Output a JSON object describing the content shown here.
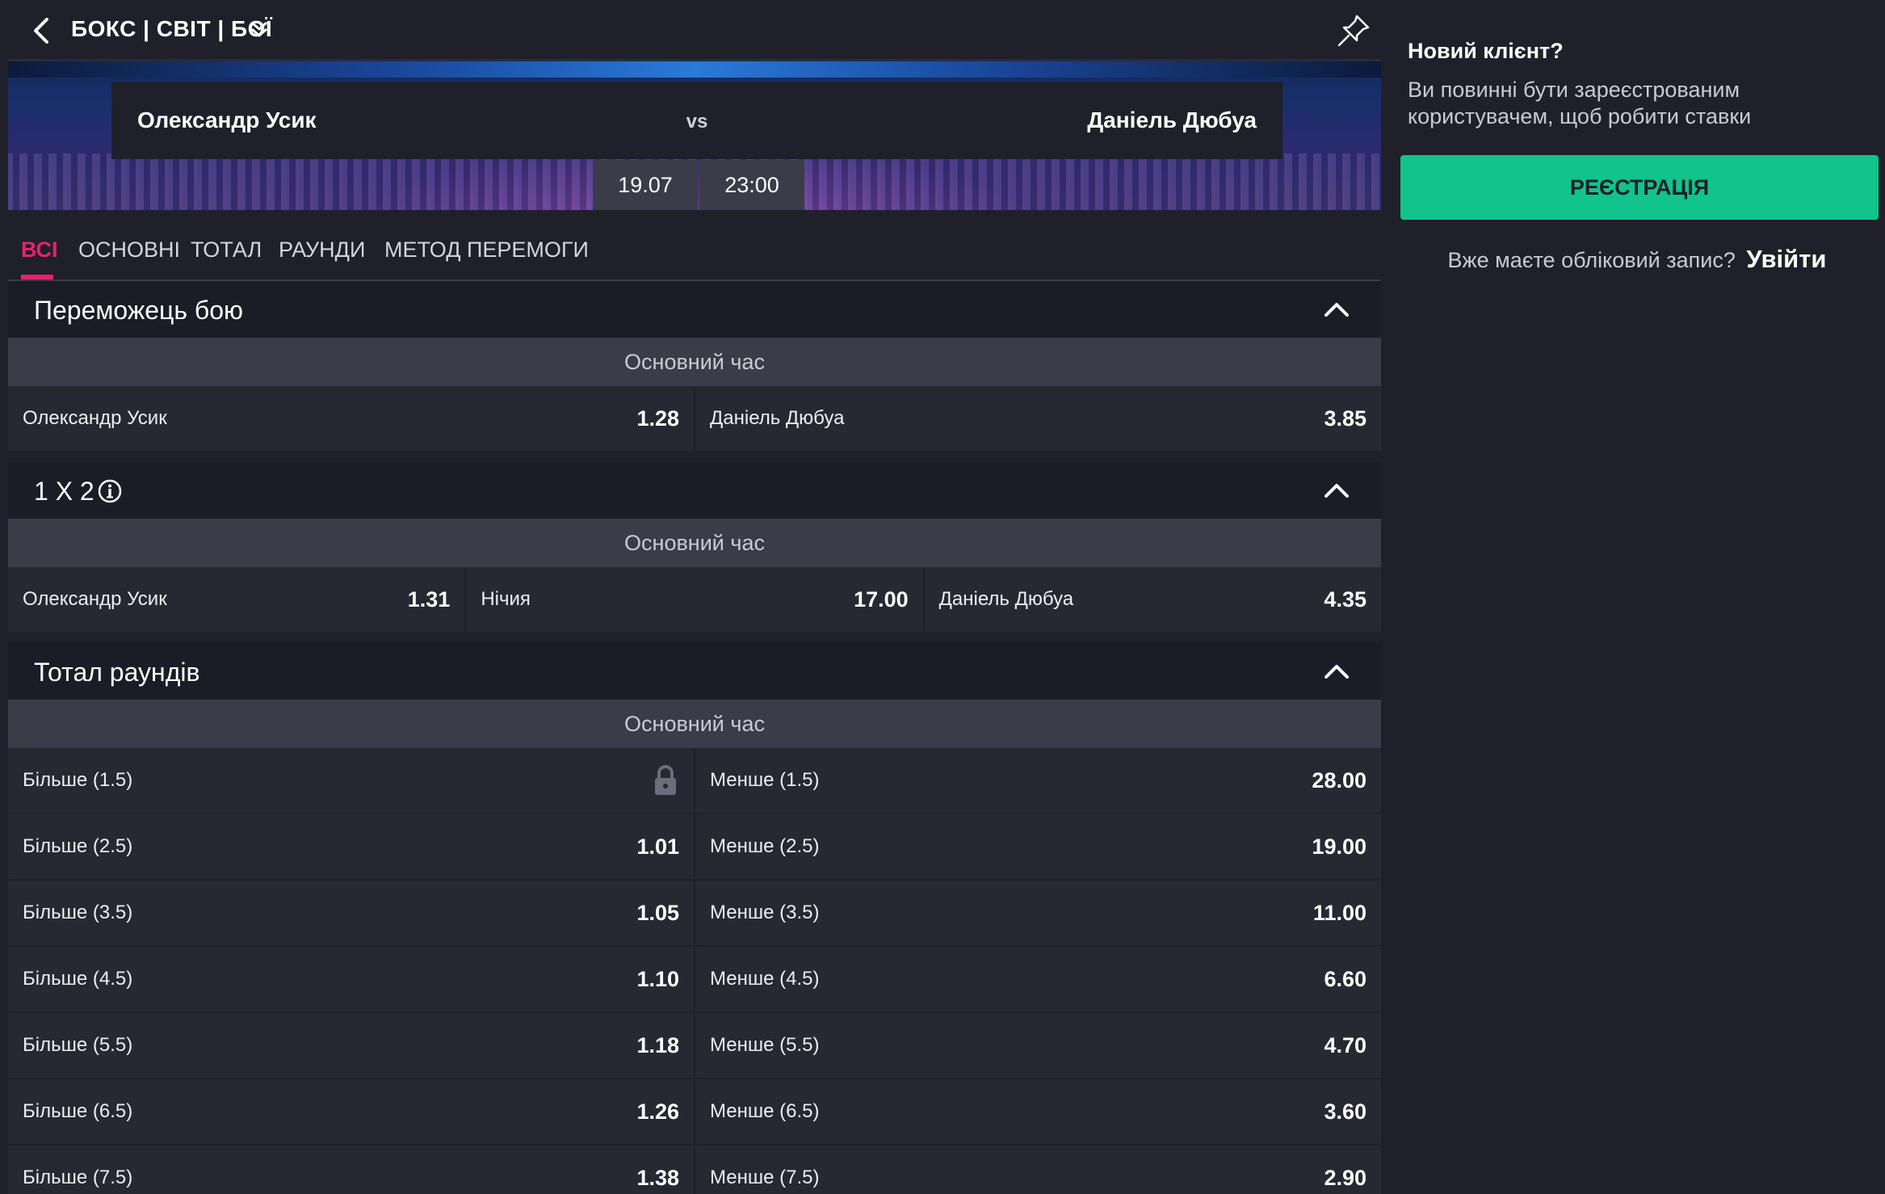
{
  "header": {
    "breadcrumb": "БОКС | СВІТ | БОЇ"
  },
  "event": {
    "home": "Олександр Усик",
    "vs": "vs",
    "away": "Даніель Дюбуа",
    "date": "19.07",
    "time": "23:00"
  },
  "tabs": [
    {
      "label": "ВСІ"
    },
    {
      "label": "ОСНОВНІ"
    },
    {
      "label": "ТОТАЛ"
    },
    {
      "label": "РАУНДИ"
    },
    {
      "label": "МЕТОД ПЕРЕМОГИ"
    }
  ],
  "markets": {
    "winner": {
      "title": "Переможець бою",
      "period": "Основний час",
      "home_label": "Олександр Усик",
      "home_odd": "1.28",
      "away_label": "Даніель Дюбуа",
      "away_odd": "3.85"
    },
    "x12": {
      "title": "1 X 2",
      "period": "Основний час",
      "home_label": "Олександр Усик",
      "home_odd": "1.31",
      "draw_label": "Нічия",
      "draw_odd": "17.00",
      "away_label": "Даніель Дюбуа",
      "away_odd": "4.35"
    },
    "total": {
      "title": "Тотал раундів",
      "period": "Основний час",
      "rows": [
        {
          "over": "Більше (1.5)",
          "over_odd": "",
          "under": "Менше (1.5)",
          "under_odd": "28.00"
        },
        {
          "over": "Більше (2.5)",
          "over_odd": "1.01",
          "under": "Менше (2.5)",
          "under_odd": "19.00"
        },
        {
          "over": "Більше (3.5)",
          "over_odd": "1.05",
          "under": "Менше (3.5)",
          "under_odd": "11.00"
        },
        {
          "over": "Більше (4.5)",
          "over_odd": "1.10",
          "under": "Менше (4.5)",
          "under_odd": "6.60"
        },
        {
          "over": "Більше (5.5)",
          "over_odd": "1.18",
          "under": "Менше (5.5)",
          "under_odd": "4.70"
        },
        {
          "over": "Більше (6.5)",
          "over_odd": "1.26",
          "under": "Менше (6.5)",
          "under_odd": "3.60"
        },
        {
          "over": "Більше (7.5)",
          "over_odd": "1.38",
          "under": "Менше (7.5)",
          "under_odd": "2.90"
        }
      ]
    }
  },
  "side": {
    "title": "Новий клієнт?",
    "text": "Ви повинні бути зареєстрованим користувачем, щоб робити ставки",
    "register": "РЕЄСТРАЦІЯ",
    "login_prompt": "Вже маєте обліковий запис?",
    "login_link": "Увійти"
  },
  "colors": {
    "accent": "#e8216d",
    "register": "#12c38b",
    "background": "#1f2029",
    "row": "#272832",
    "subheader": "#3a3c49"
  }
}
